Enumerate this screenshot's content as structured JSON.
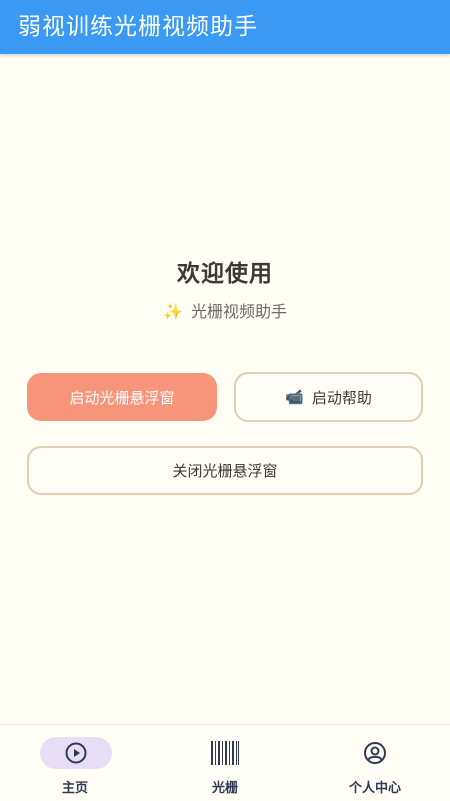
{
  "app_bar": {
    "title": "弱视训练光栅视频助手"
  },
  "main": {
    "welcome": "欢迎使用",
    "subtitle_icon": "✨",
    "subtitle": "光栅视频助手",
    "start_button": "启动光栅悬浮窗",
    "help_icon": "📹",
    "help_button": "启动帮助",
    "close_button": "关闭光栅悬浮窗"
  },
  "bottom_nav": {
    "items": [
      {
        "label": "主页",
        "icon": "play-circle-icon",
        "active": true
      },
      {
        "label": "光栅",
        "icon": "barcode-icon",
        "active": false
      },
      {
        "label": "个人中心",
        "icon": "user-circle-icon",
        "active": false
      }
    ]
  },
  "colors": {
    "app_bar": "#3a9af3",
    "primary_button": "#f7957a",
    "outline_border": "#e2cfae",
    "background": "#fffdf4",
    "nav_active_pill": "#e7ddf4"
  }
}
